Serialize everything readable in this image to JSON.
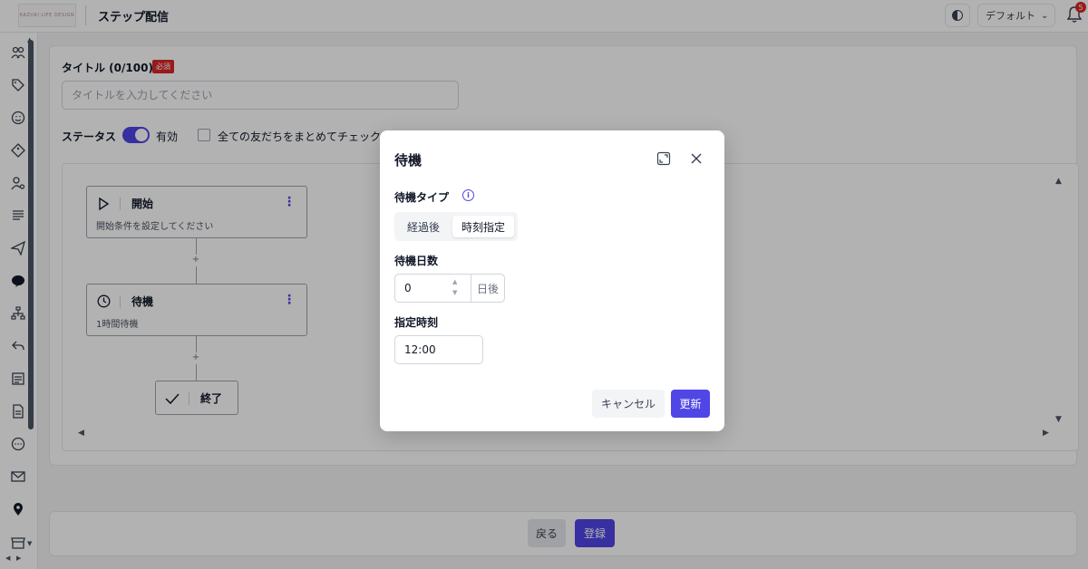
{
  "header": {
    "logo_text": "KAZUKI LIFE DESIGN",
    "page_title": "ステップ配信",
    "theme_icon": "contrast-icon",
    "font_select": "デフォルト",
    "notification_count": "5"
  },
  "form": {
    "title_label": "タイトル (0/100)",
    "required_badge": "必須",
    "title_placeholder": "タイトルを入力してください",
    "title_value": "",
    "status_label": "ステータス",
    "status_enabled": true,
    "status_text": "有効",
    "bulk_check_label": "全ての友だちをまとめてチェック"
  },
  "flow": {
    "nodes": [
      {
        "icon": "play-icon",
        "title": "開始",
        "subtitle": "開始条件を設定してください"
      },
      {
        "icon": "clock-icon",
        "title": "待機",
        "subtitle": "1時間待機"
      },
      {
        "icon": "check-icon",
        "title": "終了"
      }
    ],
    "plus": "+"
  },
  "footer": {
    "back_label": "戻る",
    "register_label": "登録"
  },
  "modal": {
    "title": "待機",
    "wait_type_label": "待機タイプ",
    "wait_type_options": [
      "経過後",
      "時刻指定"
    ],
    "wait_type_selected": "時刻指定",
    "wait_days_label": "待機日数",
    "wait_days_value": "0",
    "wait_days_suffix": "日後",
    "time_label": "指定時刻",
    "time_value": "12:00",
    "cancel_label": "キャンセル",
    "update_label": "更新"
  },
  "colors": {
    "accent": "#4f46e5",
    "required": "#dc2626"
  }
}
